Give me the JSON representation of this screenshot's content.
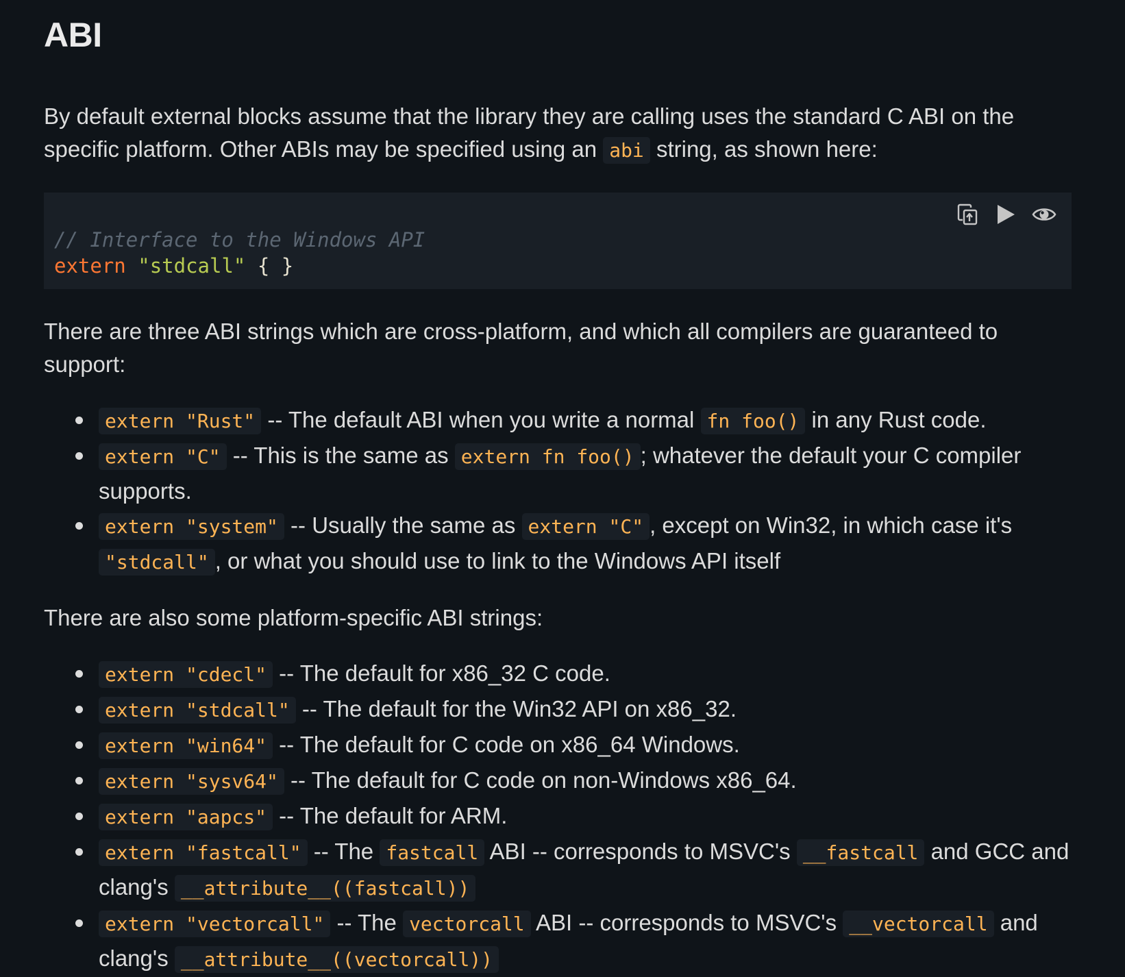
{
  "heading": "ABI",
  "intro": {
    "text1": "By default external blocks assume that the library they are calling uses the standard C ABI on the specific platform. Other ABIs may be specified using an ",
    "code1": "abi",
    "text2": " string, as shown here:"
  },
  "code_block": {
    "comment": "// Interface to the Windows API",
    "keyword": "extern",
    "string": "\"stdcall\"",
    "braces": "{ }",
    "buttons": {
      "copy_icon": "copy-icon",
      "run_icon": "play-icon",
      "toggle_icon": "eye-icon"
    }
  },
  "cross_platform_intro": "There are three ABI strings which are cross-platform, and which all compilers are guaranteed to support:",
  "cross_platform": [
    {
      "code": "extern \"Rust\"",
      "text1": " -- The default ABI when you write a normal ",
      "code2": "fn foo()",
      "text2": " in any Rust code."
    },
    {
      "code": "extern \"C\"",
      "text1": " -- This is the same as ",
      "code2": "extern fn foo()",
      "text2": "; whatever the default your C compiler supports."
    },
    {
      "code": "extern \"system\"",
      "text1": " -- Usually the same as ",
      "code2": "extern \"C\"",
      "text2": ", except on Win32, in which case it's ",
      "code3": "\"stdcall\"",
      "text3": ", or what you should use to link to the Windows API itself"
    }
  ],
  "platform_specific_intro": "There are also some platform-specific ABI strings:",
  "platform_specific": [
    {
      "code": "extern \"cdecl\"",
      "text1": " -- The default for x86_32 C code."
    },
    {
      "code": "extern \"stdcall\"",
      "text1": " -- The default for the Win32 API on x86_32."
    },
    {
      "code": "extern \"win64\"",
      "text1": " -- The default for C code on x86_64 Windows."
    },
    {
      "code": "extern \"sysv64\"",
      "text1": " -- The default for C code on non-Windows x86_64."
    },
    {
      "code": "extern \"aapcs\"",
      "text1": " -- The default for ARM."
    },
    {
      "code": "extern \"fastcall\"",
      "text1": " -- The ",
      "code2": "fastcall",
      "text2": " ABI -- corresponds to MSVC's ",
      "code3": "__fastcall",
      "text3": " and GCC and clang's ",
      "code4": "__attribute__((fastcall))",
      "text4": ""
    },
    {
      "code": "extern \"vectorcall\"",
      "text1": " -- The ",
      "code2": "vectorcall",
      "text2": " ABI -- corresponds to MSVC's ",
      "code3": "__vectorcall",
      "text3": " and clang's ",
      "code4": "__attribute__((vectorcall))",
      "text4": ""
    }
  ]
}
